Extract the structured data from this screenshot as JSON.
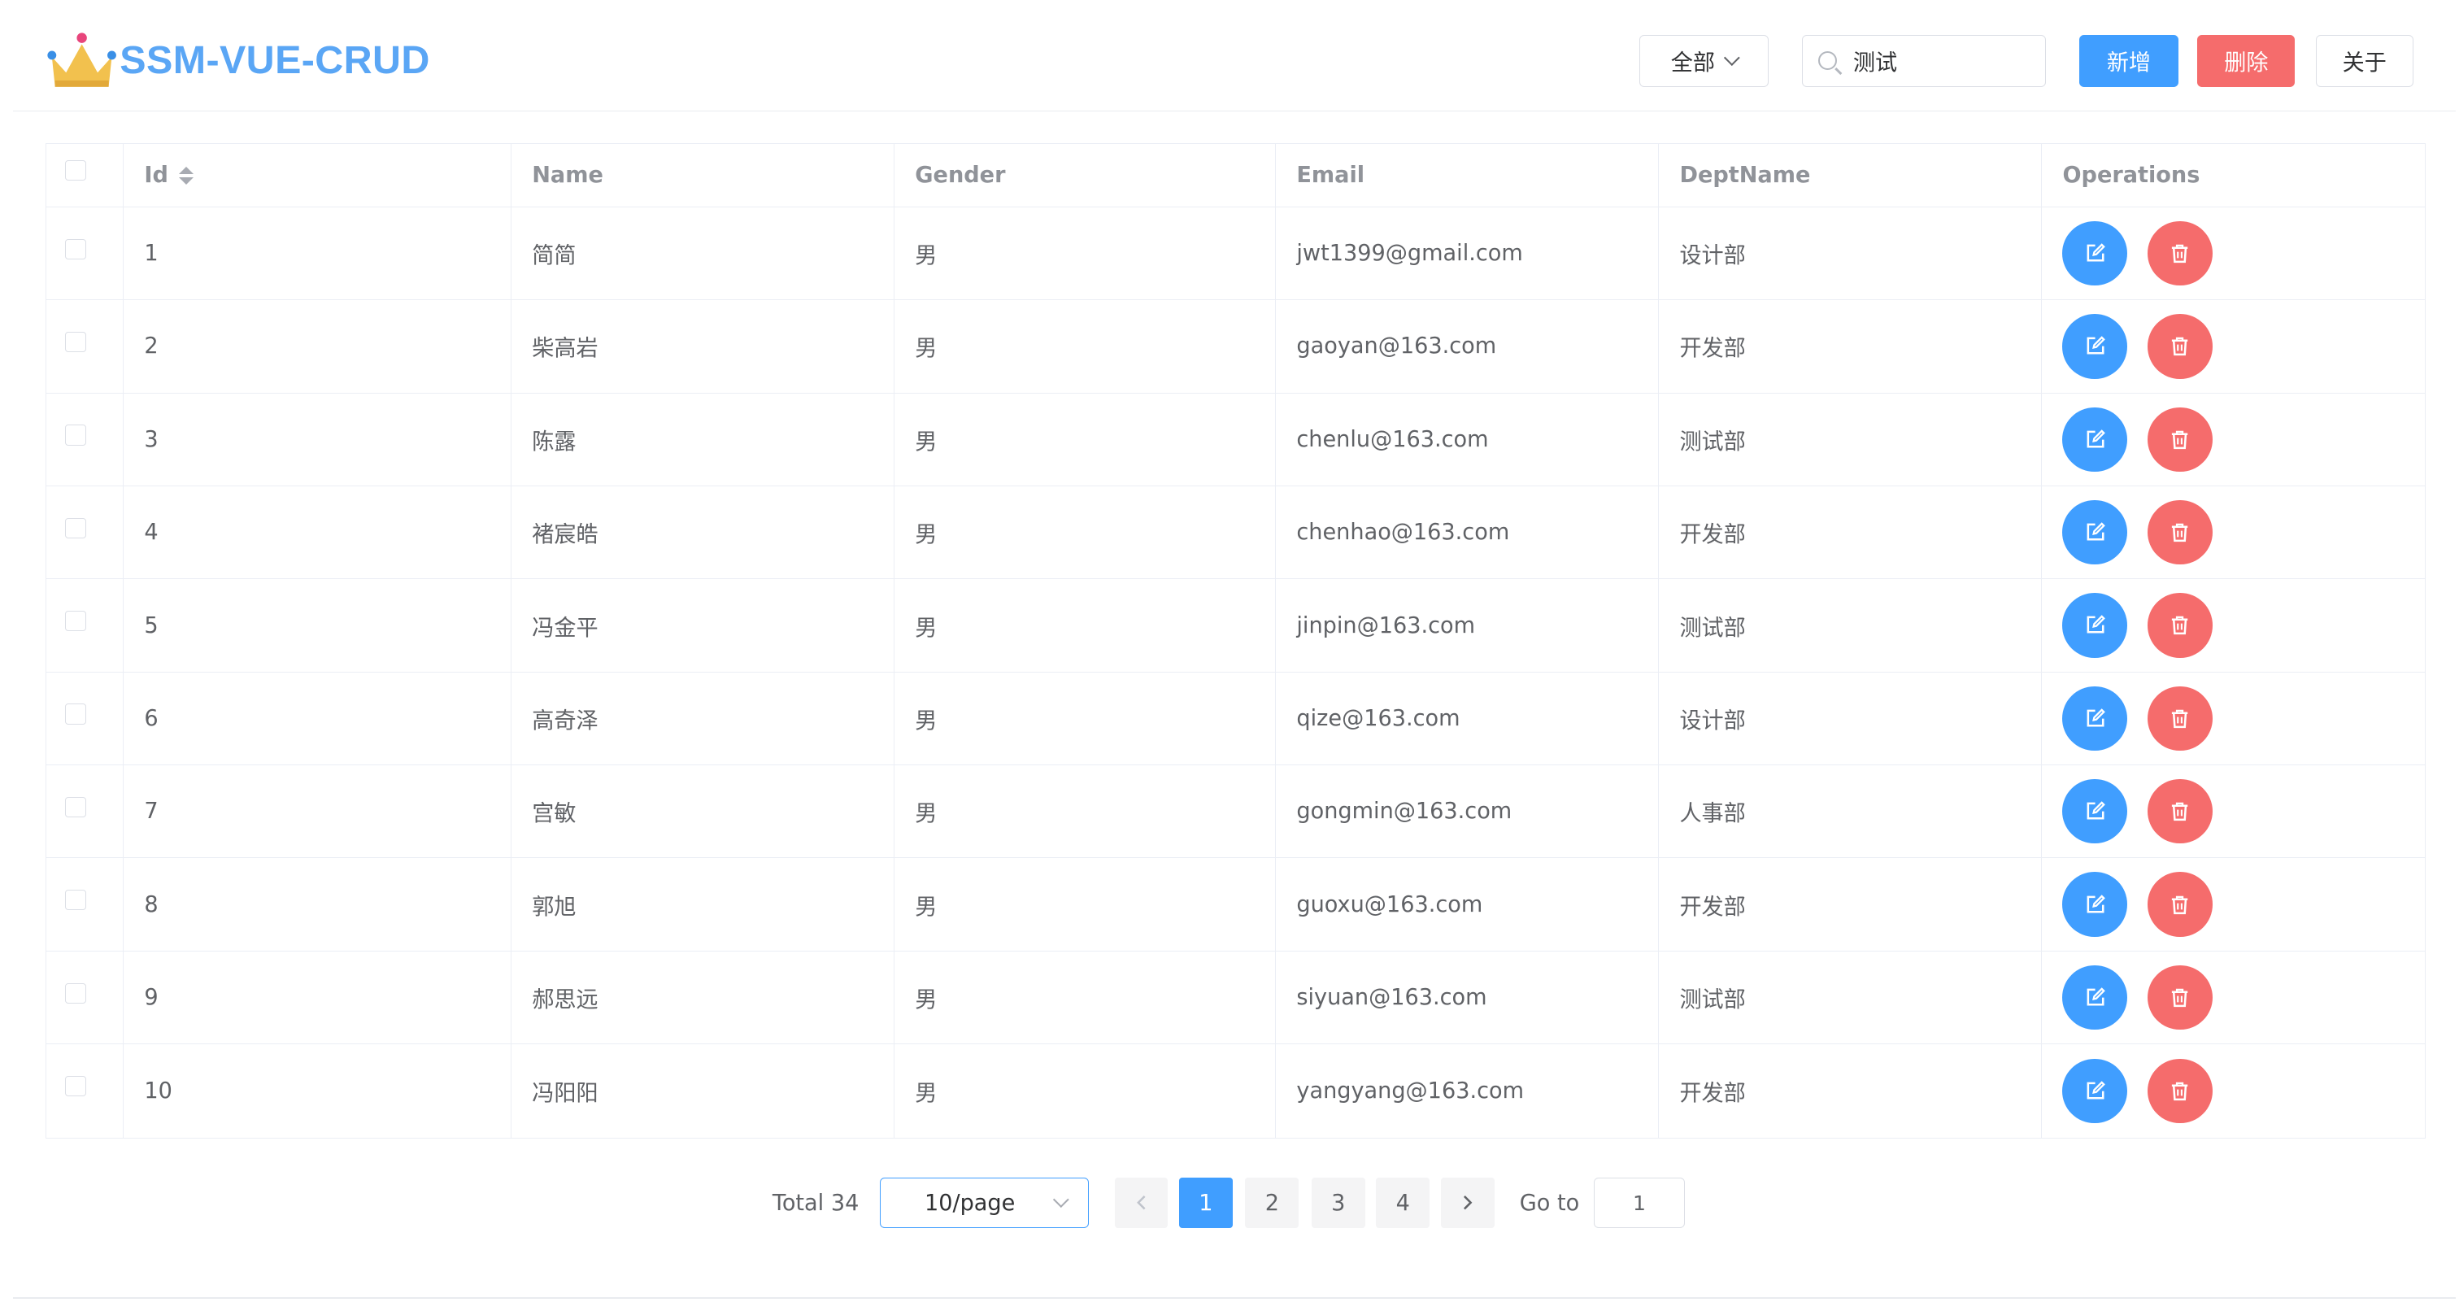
{
  "app": {
    "title": "SSM-VUE-CRUD"
  },
  "header": {
    "dept_filter": "全部",
    "search_value": "测试",
    "add_label": "新增",
    "delete_label": "删除",
    "about_label": "关于"
  },
  "table": {
    "columns": [
      "Id",
      "Name",
      "Gender",
      "Email",
      "DeptName",
      "Operations"
    ],
    "rows": [
      {
        "id": "1",
        "name": "简简",
        "gender": "男",
        "email": "jwt1399@gmail.com",
        "dept": "设计部"
      },
      {
        "id": "2",
        "name": "柴高岩",
        "gender": "男",
        "email": "gaoyan@163.com",
        "dept": "开发部"
      },
      {
        "id": "3",
        "name": "陈露",
        "gender": "男",
        "email": "chenlu@163.com",
        "dept": "测试部"
      },
      {
        "id": "4",
        "name": "褚宸皓",
        "gender": "男",
        "email": "chenhao@163.com",
        "dept": "开发部"
      },
      {
        "id": "5",
        "name": "冯金平",
        "gender": "男",
        "email": "jinpin@163.com",
        "dept": "测试部"
      },
      {
        "id": "6",
        "name": "高奇泽",
        "gender": "男",
        "email": "qize@163.com",
        "dept": "设计部"
      },
      {
        "id": "7",
        "name": "宫敏",
        "gender": "男",
        "email": "gongmin@163.com",
        "dept": "人事部"
      },
      {
        "id": "8",
        "name": "郭旭",
        "gender": "男",
        "email": "guoxu@163.com",
        "dept": "开发部"
      },
      {
        "id": "9",
        "name": "郝思远",
        "gender": "男",
        "email": "siyuan@163.com",
        "dept": "测试部"
      },
      {
        "id": "10",
        "name": "冯阳阳",
        "gender": "男",
        "email": "yangyang@163.com",
        "dept": "开发部"
      }
    ]
  },
  "pagination": {
    "total_label": "Total 34",
    "page_size": "10/page",
    "pages": [
      "1",
      "2",
      "3",
      "4"
    ],
    "current_page": "1",
    "goto_label": "Go to",
    "goto_value": "1"
  },
  "colors": {
    "primary": "#409eff",
    "danger": "#f56c6c",
    "logo_text": "#5aa6f5"
  },
  "icons": {
    "logo": "crown-icon",
    "edit": "edit-icon",
    "delete": "trash-icon",
    "search": "search-icon"
  }
}
